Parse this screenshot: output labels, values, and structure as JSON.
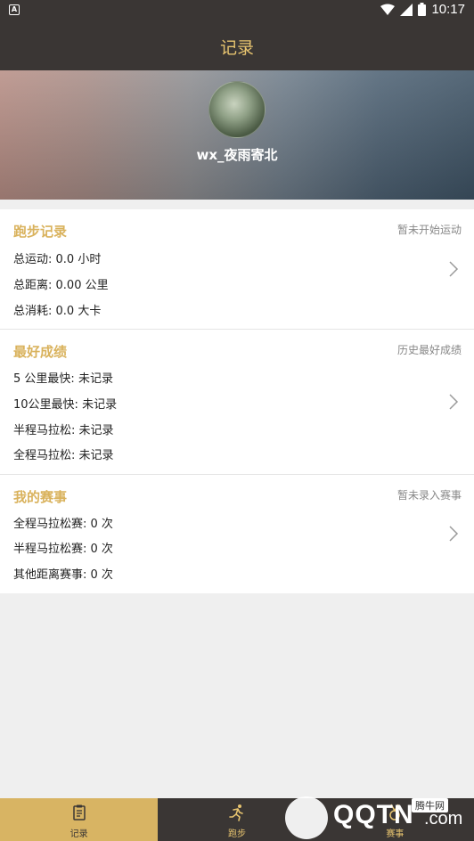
{
  "status_bar": {
    "time": "10:17"
  },
  "app_bar": {
    "title": "记录"
  },
  "profile": {
    "username": "wx_夜雨寄北"
  },
  "running_record": {
    "title": "跑步记录",
    "hint": "暂未开始运动",
    "rows": [
      {
        "label": "总运动:",
        "value": "0.0 小时"
      },
      {
        "label": "总距离:",
        "value": "0.00 公里"
      },
      {
        "label": "总消耗:",
        "value": "0.0 大卡"
      }
    ]
  },
  "best_results": {
    "title": "最好成绩",
    "hint": "历史最好成绩",
    "rows": [
      {
        "label": "5  公里最快:",
        "value": "未记录"
      },
      {
        "label": "10公里最快:",
        "value": "未记录"
      },
      {
        "label": " 半程马拉松:",
        "value": "未记录"
      },
      {
        "label": " 全程马拉松:",
        "value": "未记录"
      }
    ]
  },
  "my_events": {
    "title": "我的赛事",
    "hint": "暂未录入赛事",
    "rows": [
      {
        "label": "全程马拉松赛:",
        "value": "0 次"
      },
      {
        "label": "半程马拉松赛:",
        "value": "0 次"
      },
      {
        "label": "其他距离赛事:",
        "value": "0 次"
      }
    ]
  },
  "tabs": [
    {
      "label": "记录",
      "icon": "clipboard-icon",
      "active": true
    },
    {
      "label": "跑步",
      "icon": "runner-icon",
      "active": false
    },
    {
      "label": "赛事",
      "icon": "medal-icon",
      "active": false
    }
  ],
  "watermark": {
    "text": "QQTN",
    "suffix": ".com",
    "badge": "腾牛网"
  },
  "colors": {
    "header": "#3a3634",
    "accent": "#e7c46f",
    "section_title": "#d9b25c",
    "tab_active": "#d8b463"
  }
}
